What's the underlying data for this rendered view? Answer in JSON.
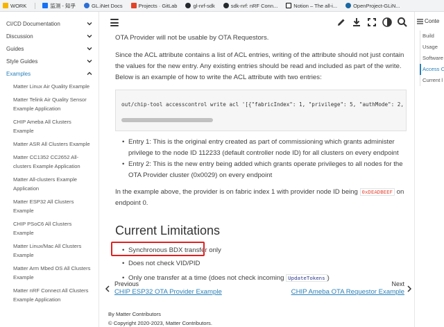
{
  "bookmarks": [
    {
      "label": "WORK",
      "color": "#f5b400"
    },
    {
      "label": "监测 - 知乎",
      "color": "#1772f6"
    },
    {
      "label": "GL.iNet Docs",
      "color": "#2b6fd6"
    },
    {
      "label": "Projects · GitLab",
      "color": "#e24329"
    },
    {
      "label": "gl-nrf-sdk",
      "color": "#24292e"
    },
    {
      "label": "sdk-nrf: nRF Conn...",
      "color": "#24292e"
    },
    {
      "label": "Notion – The all-i...",
      "color": "#000000"
    },
    {
      "label": "OpenProject-GLiN...",
      "color": "#1a67a3"
    }
  ],
  "sidebar": {
    "sections": [
      {
        "label": "CI/CD Documentation"
      },
      {
        "label": "Discussion"
      },
      {
        "label": "Guides"
      },
      {
        "label": "Style Guides"
      }
    ],
    "active_section": "Examples",
    "items": [
      "Matter Linux Air Quality Example",
      "Matter Telink Air Quality Sensor Example Application",
      "CHIP Ameba All Clusters Example",
      "Matter ASR All Clusters Example",
      "Matter CC1352 CC2652 All-clusters Example Application",
      "Matter All-clusters Example Application",
      "Matter ESP32 All Clusters Example",
      "CHIP PSoC6 All Clusters Example",
      "Matter Linux/Mac All Clusters Example",
      "Matter Arm Mbed OS All Clusters Example",
      "Matter nRF Connect All Clusters Example Application"
    ]
  },
  "content": {
    "p_intro": "OTA Provider will not be usable by OTA Requestors.",
    "p_acl": "Since the ACL attribute contains a list of ACL entries, writing of the attribute should not just contain the values for the new entry. Any existing entries should be read and included as part of the write. Below is an example of how to write the ACL attribute with two entries:",
    "code": "out/chip-tool accesscontrol write acl '[{\"fabricIndex\": 1, \"privilege\": 5, \"authMode\": 2, \"",
    "entries": [
      "Entry 1: This is the original entry created as part of commissioning which grants administer privilege to the node ID 112233 (default controller node ID) for all clusters on every endpoint",
      "Entry 2: This is the new entry being added which grants operate privileges to all nodes for the OTA Provider cluster (0x0029) on every endpoint"
    ],
    "p_example_before": "In the example above, the provider is on fabric index 1 with provider node ID being ",
    "p_example_code": "0xDEADBEEF",
    "p_example_on": " on",
    "p_example_after": "endpoint 0.",
    "heading": "Current Limitations",
    "limitations": [
      "Synchronous BDX transfer only",
      "Does not check VID/PID"
    ],
    "limitation_last_before": "Only one transfer at a time (does not check incoming ",
    "limitation_last_code": "UpdateTokens",
    "limitation_last_after": ")"
  },
  "nav": {
    "prev_label": "Previous",
    "prev_title": "CHIP ESP32 OTA Provider Example",
    "next_label": "Next",
    "next_title": "CHIP Ameba OTA Requestor Example"
  },
  "footer": {
    "by": "By Matter Contributors",
    "copyright": "© Copyright 2020-2023, Matter Contributors."
  },
  "toc": {
    "title": "Conte",
    "items": [
      "Build",
      "Usage",
      "Software",
      "Access C",
      "Current l"
    ],
    "active_index": 3
  },
  "colors": {
    "accent": "#2980b9",
    "highlight_box": "#e02020",
    "code_text": "#e74c3c"
  }
}
